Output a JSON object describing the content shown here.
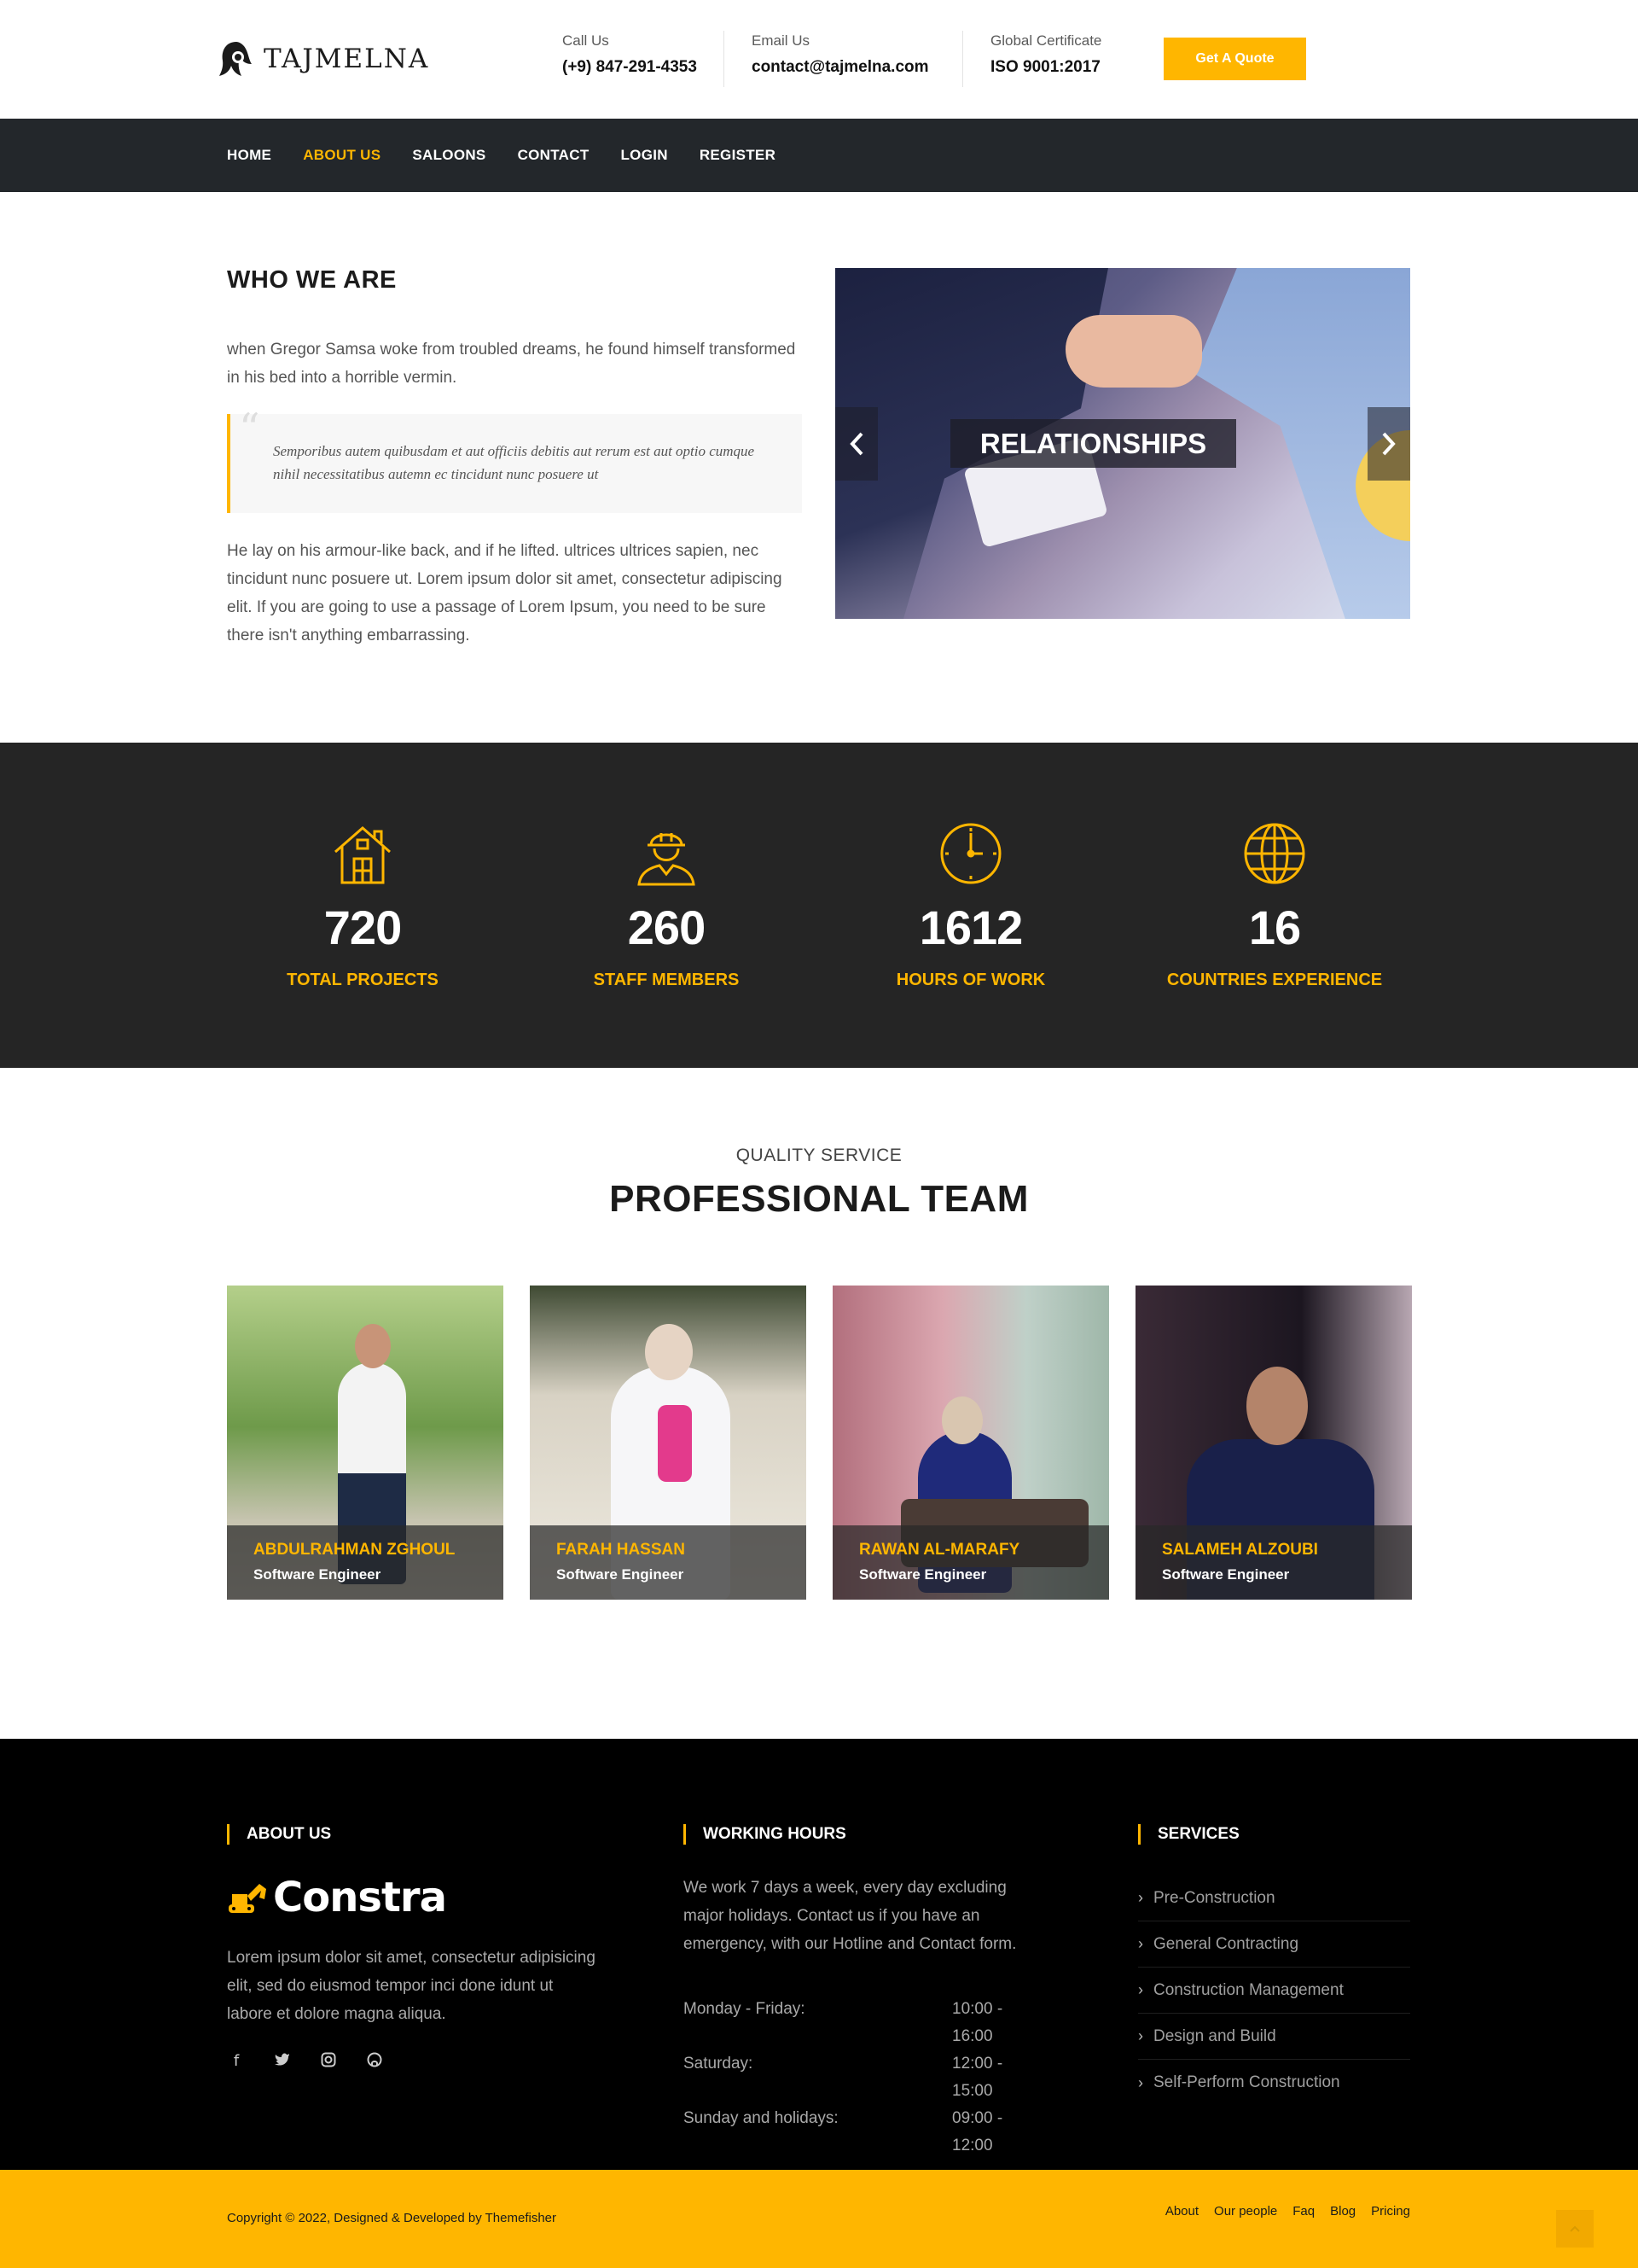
{
  "brand": {
    "name": "TAJMELNA"
  },
  "header": {
    "call": {
      "label": "Call Us",
      "value": "(+9) 847-291-4353"
    },
    "email": {
      "label": "Email Us",
      "value": "contact@tajmelna.com"
    },
    "certificate": {
      "label": "Global Certificate",
      "value": "ISO 9001:2017"
    },
    "quote_button": "Get A Quote"
  },
  "nav": {
    "items": [
      "HOME",
      "ABOUT US",
      "SALOONS",
      "CONTACT",
      "LOGIN",
      "REGISTER"
    ],
    "active": "ABOUT US"
  },
  "who": {
    "title": "WHO WE ARE",
    "lead": "when Gregor Samsa woke from troubled dreams, he found himself transformed in his bed into a horrible vermin.",
    "quote": "Semporibus autem quibusdam et aut officiis debitis aut rerum est aut optio cumque nihil necessitatibus autemn ec tincidunt nunc posuere ut",
    "body": "He lay on his armour-like back, and if he lifted. ultrices ultrices sapien, nec tincidunt nunc posuere ut. Lorem ipsum dolor sit amet, consectetur adipiscing elit. If you are going to use a passage of Lorem Ipsum, you need to be sure there isn't anything embarrassing."
  },
  "slider": {
    "caption": "RELATIONSHIPS",
    "prev_icon": "chevron-left-icon",
    "next_icon": "chevron-right-icon"
  },
  "stats": [
    {
      "icon": "house-icon",
      "value": "720",
      "label": "TOTAL PROJECTS"
    },
    {
      "icon": "worker-icon",
      "value": "260",
      "label": "STAFF MEMBERS"
    },
    {
      "icon": "clock-icon",
      "value": "1612",
      "label": "HOURS OF WORK"
    },
    {
      "icon": "globe-icon",
      "value": "16",
      "label": "COUNTRIES EXPERIENCE"
    }
  ],
  "team": {
    "subtitle": "QUALITY SERVICE",
    "title": "PROFESSIONAL TEAM",
    "members": [
      {
        "name": "ABDULRAHMAN ZGHOUL",
        "role": "Software Engineer"
      },
      {
        "name": "FARAH HASSAN",
        "role": "Software Engineer"
      },
      {
        "name": "RAWAN AL-MARAFY",
        "role": "Software Engineer"
      },
      {
        "name": "SALAMEH ALZOUBI",
        "role": "Software Engineer"
      }
    ]
  },
  "footer": {
    "about": {
      "title": "ABOUT US",
      "brand": "Constra",
      "text": "Lorem ipsum dolor sit amet, consectetur adipisicing elit, sed do eiusmod tempor inci done idunt ut labore et dolore magna aliqua.",
      "socials": [
        "facebook-icon",
        "twitter-icon",
        "instagram-icon",
        "github-icon"
      ]
    },
    "hours": {
      "title": "WORKING HOURS",
      "text": "We work 7 days a week, every day excluding major holidays. Contact us if you have an emergency, with our Hotline and Contact form.",
      "rows": [
        {
          "day": "Monday - Friday:",
          "time": "10:00 - 16:00"
        },
        {
          "day": "Saturday:",
          "time": "12:00 - 15:00"
        },
        {
          "day": "Sunday and holidays:",
          "time": "09:00 - 12:00"
        }
      ]
    },
    "services": {
      "title": "SERVICES",
      "items": [
        "Pre-Construction",
        "General Contracting",
        "Construction Management",
        "Design and Build",
        "Self-Perform Construction"
      ]
    }
  },
  "copyright": {
    "text": "Copyright © 2022, Designed & Developed by Themefisher",
    "links": [
      "About",
      "Our people",
      "Faq",
      "Blog",
      "Pricing"
    ]
  },
  "colors": {
    "accent": "#ffb600",
    "nav_bg": "#23272b",
    "stats_bg": "#252525",
    "footer_bg": "#000000"
  }
}
